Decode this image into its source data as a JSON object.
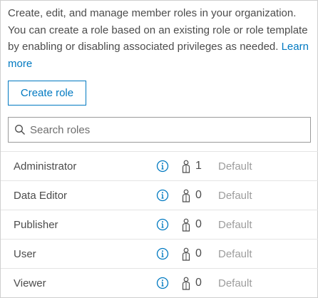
{
  "intro": {
    "text": "Create, edit, and manage member roles in your organization. You can create a role based on an existing role or role template by enabling or disabling associated privileges as needed.",
    "link_label": "Learn more"
  },
  "create_button_label": "Create role",
  "search": {
    "placeholder": "Search roles",
    "value": ""
  },
  "roles": [
    {
      "name": "Administrator",
      "members": "1",
      "status": "Default"
    },
    {
      "name": "Data Editor",
      "members": "0",
      "status": "Default"
    },
    {
      "name": "Publisher",
      "members": "0",
      "status": "Default"
    },
    {
      "name": "User",
      "members": "0",
      "status": "Default"
    },
    {
      "name": "Viewer",
      "members": "0",
      "status": "Default"
    }
  ],
  "icons": {
    "search": "search-icon",
    "info": "info-icon",
    "member": "member-icon"
  },
  "colors": {
    "accent": "#0079c1",
    "text": "#4c4c4c",
    "muted": "#9d9d9d",
    "divider": "#e4e4e4"
  }
}
